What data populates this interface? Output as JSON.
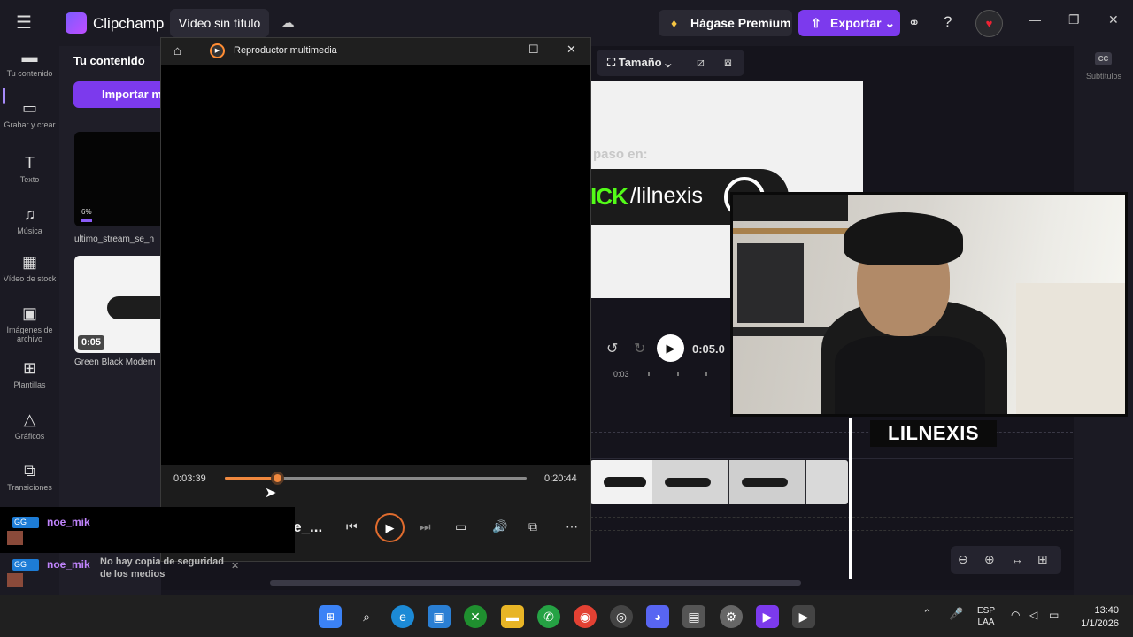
{
  "app": {
    "name": "Clipchamp",
    "title": "Vídeo sin título",
    "premium_label": "Hágase Premium",
    "export_label": "Exportar"
  },
  "nav": [
    {
      "label": "Tu contenido",
      "icon": "folder-icon"
    },
    {
      "label": "Grabar y crear",
      "icon": "camera-icon"
    },
    {
      "label": "Texto",
      "icon": "text-icon"
    },
    {
      "label": "Música",
      "icon": "music-icon"
    },
    {
      "label": "Vídeo de stock",
      "icon": "film-icon"
    },
    {
      "label": "Imágenes de archivo",
      "icon": "image-icon"
    },
    {
      "label": "Plantillas",
      "icon": "templates-icon"
    },
    {
      "label": "Gráficos",
      "icon": "shapes-icon"
    },
    {
      "label": "Transiciones",
      "icon": "transitions-icon"
    }
  ],
  "content": {
    "title": "Tu contenido",
    "import_label": "Importar m",
    "media": [
      {
        "name": "ultimo_stream_se_n",
        "progress": "6%"
      },
      {
        "name": "Green Black Modern",
        "duration": "0:05"
      }
    ]
  },
  "preview": {
    "size_label": "Tamaño",
    "canvas_text": "paso en:",
    "canvas_kick": "ICK",
    "canvas_handle": "/lilnexis",
    "time": "0:05.0",
    "ruler_label": "0:03"
  },
  "subtitles_label": "Subtítulos",
  "player": {
    "window_title": "Reproductor multimedia",
    "current_time": "0:03:39",
    "total_time": "0:20:44",
    "progress": 0.176,
    "file_name": "ultimo_stream_se_..."
  },
  "webcam": {
    "name": "LILNEXIS"
  },
  "toast": {
    "text": "No hay copia de seguridad de los medios"
  },
  "chat": [
    {
      "badge": "GG",
      "user": "noe_mik"
    },
    {
      "badge": "GG",
      "user": "noe_mik"
    },
    {
      "badge": "GG",
      "user": "noe_mik"
    }
  ],
  "taskbar": {
    "lang_line1": "ESP",
    "lang_line2": "LAA",
    "time": "13:40",
    "date": "1/1/2026"
  },
  "colors": {
    "accent": "#7c3aed",
    "player_accent": "#f0883e",
    "kick_green": "#53fc18"
  }
}
